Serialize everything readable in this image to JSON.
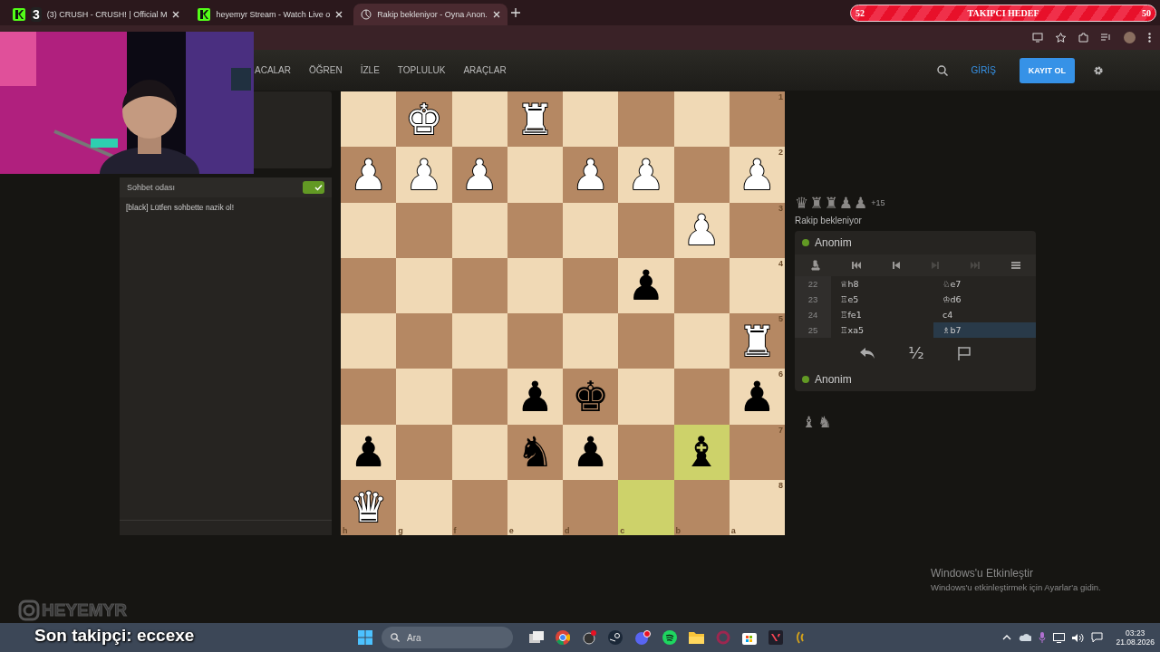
{
  "browser": {
    "tabs": [
      {
        "title": "(3) CRUSH - CRUSH! | Official M",
        "badge": "3",
        "selected": false
      },
      {
        "title": "heyemyr Stream - Watch Live o",
        "selected": false
      },
      {
        "title": "Rakip bekleniyor - Oyna Anon.",
        "selected": true
      }
    ]
  },
  "goal": {
    "current": "52",
    "title": "TAKIPCI HEDEF",
    "target": "50"
  },
  "site_nav": {
    "items": [
      "ACALAR",
      "ÖĞREN",
      "İZLE",
      "TOPLULUK",
      "ARAÇLAR"
    ],
    "login": "GİRİŞ",
    "signup": "KAYIT OL"
  },
  "chat": {
    "title": "Sohbet odası",
    "enabled": true,
    "messages": [
      {
        "user": "[black]",
        "text": "Lütfen sohbette nazik ol!"
      }
    ]
  },
  "board": {
    "ranks": [
      "1",
      "2",
      "3",
      "4",
      "5",
      "6",
      "7",
      "8"
    ],
    "files": [
      "h",
      "g",
      "f",
      "e",
      "d",
      "c",
      "b",
      "a"
    ],
    "rows": [
      [
        {
          "highlighted": false
        },
        {
          "piece": "♚",
          "white": true,
          "highlighted": false
        },
        {
          "highlighted": false
        },
        {
          "piece": "♜",
          "white": true,
          "highlighted": false
        },
        {
          "highlighted": false
        },
        {
          "highlighted": false
        },
        {
          "highlighted": false
        },
        {
          "highlighted": false
        }
      ],
      [
        {
          "piece": "♟",
          "white": true,
          "highlighted": false
        },
        {
          "piece": "♟",
          "white": true,
          "highlighted": false
        },
        {
          "piece": "♟",
          "white": true,
          "highlighted": false
        },
        {
          "highlighted": false
        },
        {
          "piece": "♟",
          "white": true,
          "highlighted": false
        },
        {
          "piece": "♟",
          "white": true,
          "highlighted": false
        },
        {
          "highlighted": false
        },
        {
          "piece": "♟",
          "white": true,
          "highlighted": false
        }
      ],
      [
        {
          "highlighted": false
        },
        {
          "highlighted": false
        },
        {
          "highlighted": false
        },
        {
          "highlighted": false
        },
        {
          "highlighted": false
        },
        {
          "highlighted": false
        },
        {
          "piece": "♟",
          "white": true,
          "highlighted": false
        },
        {
          "highlighted": false
        }
      ],
      [
        {
          "highlighted": false
        },
        {
          "highlighted": false
        },
        {
          "highlighted": false
        },
        {
          "highlighted": false
        },
        {
          "highlighted": false
        },
        {
          "piece": "♟",
          "white": false,
          "highlighted": false
        },
        {
          "highlighted": false
        },
        {
          "highlighted": false
        }
      ],
      [
        {
          "highlighted": false
        },
        {
          "highlighted": false
        },
        {
          "highlighted": false
        },
        {
          "highlighted": false
        },
        {
          "highlighted": false
        },
        {
          "highlighted": false
        },
        {
          "highlighted": false
        },
        {
          "piece": "♜",
          "white": true,
          "highlighted": false
        }
      ],
      [
        {
          "highlighted": false
        },
        {
          "highlighted": false
        },
        {
          "highlighted": false
        },
        {
          "piece": "♟",
          "white": false,
          "highlighted": false
        },
        {
          "piece": "♚",
          "white": false,
          "highlighted": false
        },
        {
          "highlighted": false
        },
        {
          "highlighted": false
        },
        {
          "piece": "♟",
          "white": false,
          "highlighted": false
        }
      ],
      [
        {
          "piece": "♟",
          "white": false,
          "highlighted": false
        },
        {
          "highlighted": false
        },
        {
          "highlighted": false
        },
        {
          "piece": "♞",
          "white": false,
          "highlighted": false
        },
        {
          "piece": "♟",
          "white": false,
          "highlighted": false
        },
        {
          "highlighted": false
        },
        {
          "piece": "♝",
          "white": false,
          "highlighted": true
        },
        {
          "highlighted": false
        }
      ],
      [
        {
          "piece": "♛",
          "white": true,
          "highlighted": false
        },
        {
          "highlighted": false
        },
        {
          "highlighted": false
        },
        {
          "highlighted": false
        },
        {
          "highlighted": false
        },
        {
          "highlighted": true
        },
        {
          "highlighted": false
        },
        {
          "highlighted": false
        }
      ]
    ]
  },
  "game": {
    "captured_top": {
      "pieces": [
        "♛",
        "♜",
        "♜",
        "♟",
        "♟"
      ],
      "score": "+15"
    },
    "status": "Rakip bekleniyor",
    "players": [
      {
        "name": "Anonim",
        "online": true
      },
      {
        "name": "Anonim",
        "online": true
      }
    ],
    "controls": [
      {
        "kind": "analysis",
        "disabled": false
      },
      {
        "kind": "first",
        "disabled": false
      },
      {
        "kind": "prev",
        "disabled": false
      },
      {
        "kind": "next",
        "disabled": true
      },
      {
        "kind": "last",
        "disabled": true
      },
      {
        "kind": "menu",
        "disabled": false
      }
    ],
    "moves": [
      {
        "number": "22",
        "white": {
          "text": "♕h8",
          "selected": false
        },
        "black": {
          "text": "♘e7",
          "selected": false
        }
      },
      {
        "number": "23",
        "white": {
          "text": "♖e5",
          "selected": false
        },
        "black": {
          "text": "♔d6",
          "selected": false
        }
      },
      {
        "number": "24",
        "white": {
          "text": "♖fe1",
          "selected": false
        },
        "black": {
          "text": "c4",
          "selected": false
        }
      },
      {
        "number": "25",
        "white": {
          "text": "♖xa5",
          "selected": false
        },
        "black": {
          "text": "♗b7",
          "selected": true
        }
      }
    ],
    "actions": [
      {
        "kind": "takeback"
      },
      {
        "kind": "draw",
        "label": "½"
      },
      {
        "kind": "resign"
      }
    ],
    "captured_bottom": [
      "♝",
      "♞"
    ]
  },
  "activation": {
    "title": "Windows'u Etkinleştir",
    "text": "Windows'u etkinleştirmek için Ayarlar'a gidin."
  },
  "overlay": {
    "instagram": "HEYEMYR",
    "last_follower": "Son takipçi: eccexe"
  },
  "taskbar": {
    "search_placeholder": "Ara",
    "time": "03:23",
    "date": "21.08.2026"
  }
}
